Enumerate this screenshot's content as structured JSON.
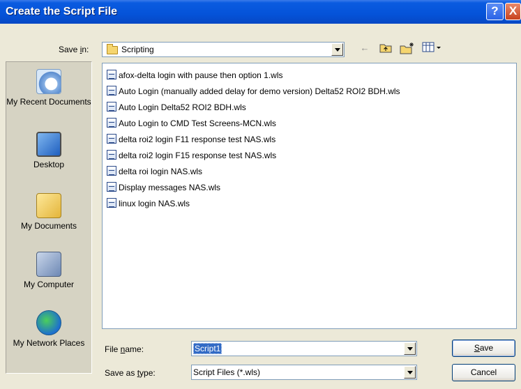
{
  "window": {
    "title": "Create the Script File",
    "help_label": "?",
    "close_label": "X"
  },
  "save_in": {
    "label": "Save in:",
    "value": "Scripting"
  },
  "toolbar": {
    "back_icon": "back-arrow-icon",
    "up_icon": "up-folder-icon",
    "new_folder_icon": "new-folder-icon",
    "views_icon": "views-menu-icon"
  },
  "places": [
    {
      "label": "My Recent Documents",
      "icon": "recent-documents-icon"
    },
    {
      "label": "Desktop",
      "icon": "desktop-icon"
    },
    {
      "label": "My Documents",
      "icon": "my-documents-icon"
    },
    {
      "label": "My Computer",
      "icon": "my-computer-icon"
    },
    {
      "label": "My Network Places",
      "icon": "network-places-icon"
    }
  ],
  "files": [
    "afox-delta login with pause then option 1.wls",
    "Auto Login (manually added delay for demo version) Delta52 ROI2 BDH.wls",
    "Auto Login Delta52 ROI2 BDH.wls",
    "Auto Login to CMD Test Screens-MCN.wls",
    "delta roi2 login F11 response test NAS.wls",
    "delta roi2 login F15 response test NAS.wls",
    "delta roi login NAS.wls",
    "Display messages NAS.wls",
    "linux login NAS.wls"
  ],
  "file_name": {
    "label": "File name:",
    "value": "Script1"
  },
  "save_as_type": {
    "label": "Save as type:",
    "value": "Script Files (*.wls)"
  },
  "buttons": {
    "save": "Save",
    "cancel": "Cancel"
  }
}
